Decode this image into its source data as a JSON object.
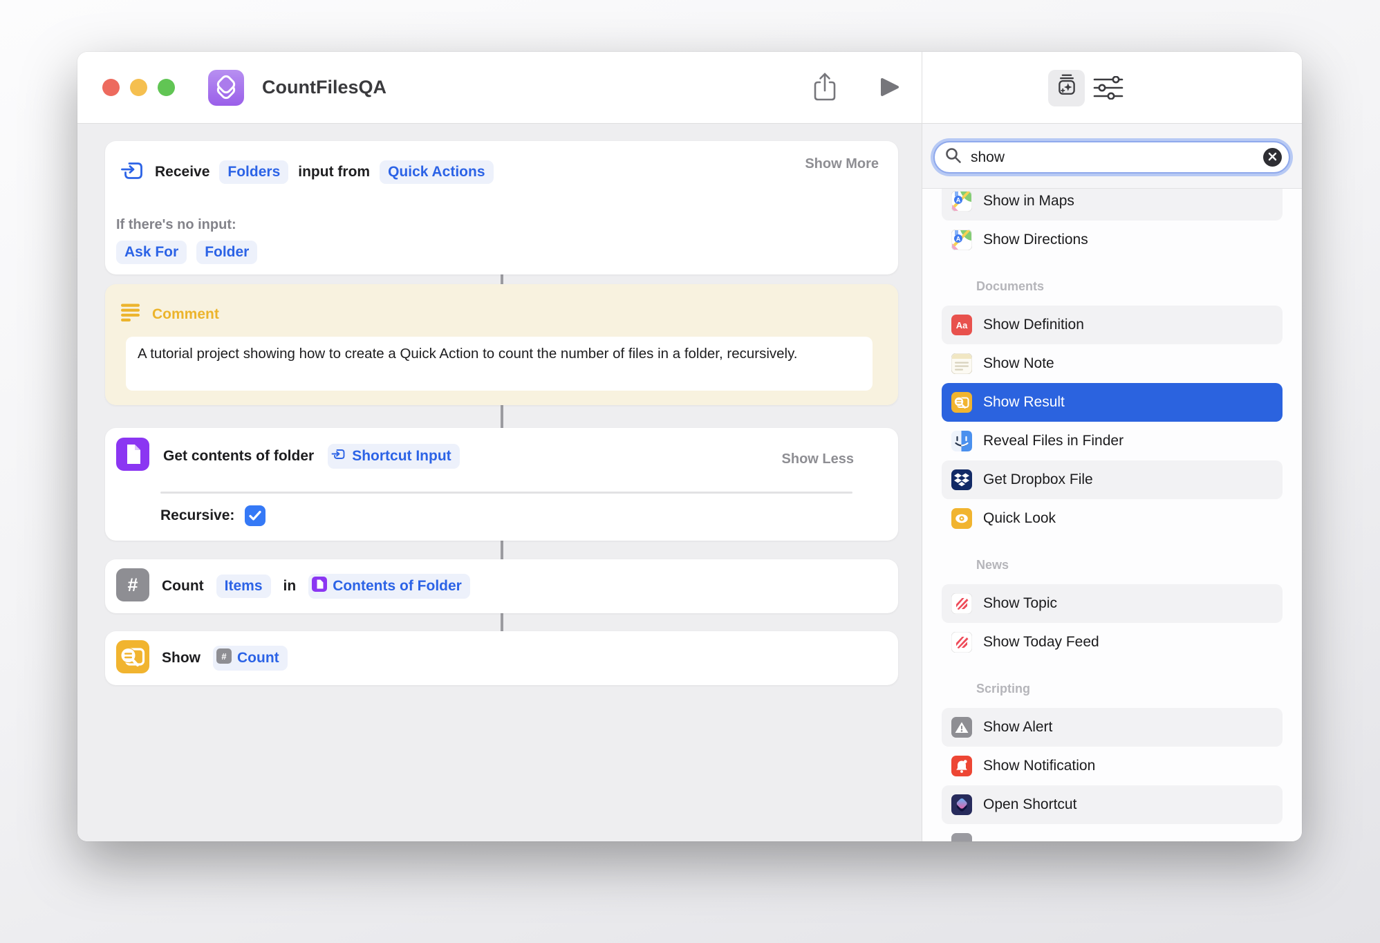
{
  "colors": {
    "accent_blue": "#2c63e6",
    "selection_blue": "#2b63df",
    "comment_yellow": "#ecb42c",
    "pill_background": "#edf1fb"
  },
  "titlebar": {
    "title": "CountFilesQA"
  },
  "editor": {
    "receive": {
      "prefix": "Receive",
      "input_type": "Folders",
      "middle": "input from",
      "source": "Quick Actions",
      "show_more": "Show More",
      "no_input_label": "If there's no input:",
      "fallback_options": [
        "Ask For",
        "Folder"
      ]
    },
    "comment": {
      "label": "Comment",
      "text": "A tutorial project showing how to create a Quick Action to count the number of files in a folder, recursively."
    },
    "get_contents": {
      "title": "Get contents of folder",
      "input_token": "Shortcut Input",
      "show_less": "Show Less",
      "recursive_label": "Recursive:",
      "recursive_checked": true
    },
    "count": {
      "verb": "Count",
      "unit_token": "Items",
      "preposition": "in",
      "source_token": "Contents of Folder"
    },
    "show": {
      "verb": "Show",
      "value_token": "Count"
    }
  },
  "panel": {
    "search": {
      "value": "show",
      "icon": "search-icon",
      "clear_icon": "clear-icon"
    },
    "results": [
      {
        "type": "item",
        "label": "Show in Maps",
        "icon": "maps",
        "clipped": true
      },
      {
        "type": "item",
        "label": "Show Directions",
        "icon": "maps"
      },
      {
        "type": "section",
        "label": "Documents"
      },
      {
        "type": "item",
        "label": "Show Definition",
        "icon": "definition"
      },
      {
        "type": "item",
        "label": "Show Note",
        "icon": "note"
      },
      {
        "type": "item",
        "label": "Show Result",
        "icon": "result",
        "selected": true
      },
      {
        "type": "item",
        "label": "Reveal Files in Finder",
        "icon": "finder"
      },
      {
        "type": "item",
        "label": "Get Dropbox File",
        "icon": "dropbox"
      },
      {
        "type": "item",
        "label": "Quick Look",
        "icon": "quicklook"
      },
      {
        "type": "section",
        "label": "News"
      },
      {
        "type": "item",
        "label": "Show Topic",
        "icon": "news"
      },
      {
        "type": "item",
        "label": "Show Today Feed",
        "icon": "news"
      },
      {
        "type": "section",
        "label": "Scripting"
      },
      {
        "type": "item",
        "label": "Show Alert",
        "icon": "alert"
      },
      {
        "type": "item",
        "label": "Show Notification",
        "icon": "notification"
      },
      {
        "type": "item",
        "label": "Open Shortcut",
        "icon": "shortcut"
      },
      {
        "type": "item",
        "label": "",
        "icon": "generic",
        "partial": true
      }
    ]
  }
}
